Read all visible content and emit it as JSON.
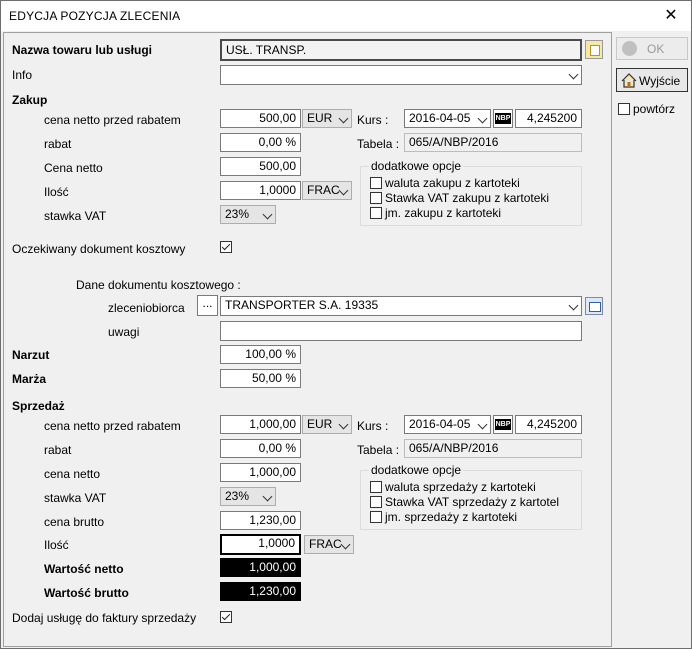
{
  "window": {
    "title": "EDYCJA POZYCJA ZLECENIA",
    "close_glyph": "✕"
  },
  "buttons": {
    "ok": "OK",
    "exit": "Wyjście",
    "repeat": "powtórz",
    "dots": "..."
  },
  "product": {
    "label": "Nazwa towaru lub usługi",
    "value": "USŁ. TRANSP."
  },
  "info": {
    "label": "Info",
    "value": ""
  },
  "purchase": {
    "heading": "Zakup",
    "net_before_discount_label": "cena netto przed rabatem",
    "net_before_discount": "500,00",
    "currency": "EUR",
    "rate_label": "Kurs :",
    "rate_date": "2016-04-05",
    "nbp": "NBP",
    "rate_value": "4,245200",
    "table_label": "Tabela :",
    "table_value": "065/A/NBP/2016",
    "discount_label": "rabat",
    "discount": "0,00 %",
    "net_label": "Cena netto",
    "net": "500,00",
    "qty_label": "Ilość",
    "qty": "1,0000",
    "unit": "FRAC",
    "vat_label": "stawka VAT",
    "vat": "23%",
    "options_title": "dodatkowe opcje",
    "opt1": "waluta zakupu z kartoteki",
    "opt2": "Stawka VAT zakupu z kartoteki",
    "opt3": "jm. zakupu z kartoteki"
  },
  "expected_doc": {
    "label": "Oczekiwany dokument kosztowy",
    "checked": true
  },
  "cost_doc": {
    "label": "Dane dokumentu kosztowego :",
    "contractor_label": "zleceniobiorca",
    "contractor_value": "TRANSPORTER S.A. 19335",
    "notes_label": "uwagi",
    "notes_value": ""
  },
  "markup": {
    "label": "Narzut",
    "value": "100,00 %"
  },
  "margin": {
    "label": "Marża",
    "value": "50,00 %"
  },
  "sale": {
    "heading": "Sprzedaż",
    "net_before_discount_label": "cena netto przed rabatem",
    "net_before_discount": "1,000,00",
    "currency": "EUR",
    "rate_label": "Kurs :",
    "rate_date": "2016-04-05",
    "nbp": "NBP",
    "rate_value": "4,245200",
    "table_label": "Tabela :",
    "table_value": "065/A/NBP/2016",
    "discount_label": "rabat",
    "discount": "0,00 %",
    "net_label": "cena netto",
    "net": "1,000,00",
    "vat_label": "stawka VAT",
    "vat": "23%",
    "gross_label": "cena brutto",
    "gross": "1,230,00",
    "qty_label": "Ilość",
    "qty": "1,0000",
    "unit": "FRAC",
    "value_net_label": "Wartość netto",
    "value_net": "1,000,00",
    "value_gross_label": "Wartość brutto",
    "value_gross": "1,230,00",
    "options_title": "dodatkowe opcje",
    "opt1": "waluta sprzedaży z kartoteki",
    "opt2": "Stawka VAT sprzedaży z kartotel",
    "opt3": "jm. sprzedaży z kartoteki"
  },
  "add_to_invoice": {
    "label": "Dodaj usługę do faktury sprzedaży",
    "checked": true
  }
}
